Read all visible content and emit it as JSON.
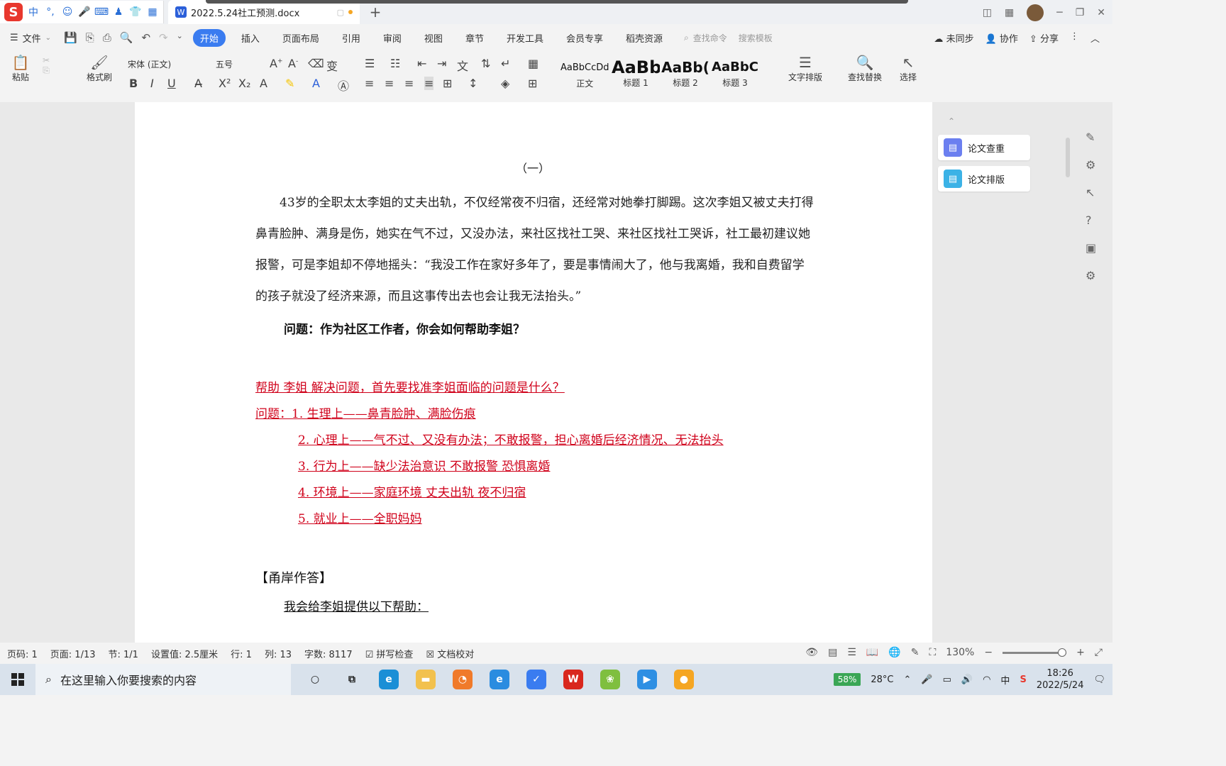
{
  "titlebar": {
    "ime_logo": "S",
    "ime_lang": "中",
    "doc_tab_title": "2022.5.24社工预测.docx",
    "new_tab": "+"
  },
  "menu": {
    "file_label": "文件",
    "tabs": [
      "开始",
      "插入",
      "页面布局",
      "引用",
      "审阅",
      "视图",
      "章节",
      "开发工具",
      "会员专享",
      "稻壳资源"
    ],
    "active_tab": "开始",
    "search_placeholder": "查找命令",
    "search_label2": "搜索模板",
    "unsynced": "未同步",
    "collab": "协作",
    "share": "分享"
  },
  "ribbon": {
    "paste": "粘贴",
    "format_painter": "格式刷",
    "font_name": "宋体 (正文)",
    "font_size": "五号",
    "bold": "B",
    "italic": "I",
    "underline": "U",
    "styles": [
      {
        "sample": "AaBbCcDd",
        "label": "正文"
      },
      {
        "sample": "AaBb",
        "label": "标题 1"
      },
      {
        "sample": "AaBb(",
        "label": "标题 2"
      },
      {
        "sample": "AaBbC",
        "label": "标题 3"
      }
    ],
    "text_layout": "文字排版",
    "find_replace": "查找替换",
    "select": "选择"
  },
  "document": {
    "heading": "（一）",
    "paragraph": "43岁的全职太太李姐的丈夫出轨，不仅经常夜不归宿，还经常对她拳打脚踢。这次李姐又被丈夫打得鼻青脸肿、满身是伤，她实在气不过，又没办法，来社区找社工哭、来社区找社工哭诉，社工最初建议她报警，可是李姐却不停地摇头：“我没工作在家好多年了，要是事情闹大了，他与我离婚，我和自费留学的孩子就没了经济来源，而且这事传出去也会让我无法抬头。”",
    "question": "问题：作为社区工作者，你会如何帮助李姐？",
    "red_lines": [
      "帮助  李姐  解决问题，首先要找准李姐面临的问题是什么？",
      "问题：1.  生理上——鼻青脸肿、满脸伤痕"
    ],
    "red_items": [
      "2.  心理上——气不过、又没有办法；不敢报警，担心离婚后经济情况、无法抬头",
      "3.  行为上——缺少法治意识  不敢报警  恐惧离婚",
      "4.  环境上——家庭环境  丈夫出轨  夜不归宿",
      "5.  就业上——全职妈妈"
    ],
    "answer_head": "【甬岸作答】",
    "answer_sub": "我会给李姐提供以下帮助："
  },
  "side_panel": {
    "check": "论文查重",
    "format": "论文排版"
  },
  "statusbar": {
    "page_code": "页码: 1",
    "page": "页面: 1/13",
    "section": "节: 1/1",
    "setting": "设置值: 2.5厘米",
    "row": "行: 1",
    "col": "列: 13",
    "words": "字数: 8117",
    "spell": "拼写检查",
    "proof": "文档校对",
    "zoom": "130%"
  },
  "taskbar": {
    "search_placeholder": "在这里输入你要搜索的内容",
    "battery": "58%",
    "temperature": "28°C",
    "time": "18:26",
    "date": "2022/5/24"
  },
  "colors": {
    "accent": "#3a7cf0",
    "red_text": "#d0021b"
  }
}
